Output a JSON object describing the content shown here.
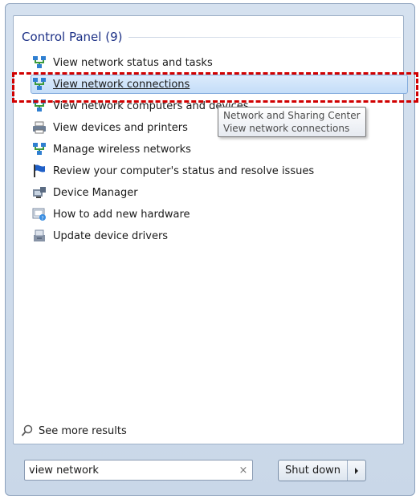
{
  "start_menu": {
    "group_title": "Control Panel (9)",
    "items": [
      {
        "label": "View network status and tasks",
        "icon": "network-icon"
      },
      {
        "label": "View network connections",
        "icon": "network-icon",
        "selected": true
      },
      {
        "label": "View network computers and devices",
        "icon": "network-icon"
      },
      {
        "label": "View devices and printers",
        "icon": "printer-icon"
      },
      {
        "label": "Manage wireless networks",
        "icon": "network-icon"
      },
      {
        "label": "Review your computer's status and resolve issues",
        "icon": "flag-icon"
      },
      {
        "label": "Device Manager",
        "icon": "device-manager-icon"
      },
      {
        "label": "How to add new hardware",
        "icon": "hardware-icon"
      },
      {
        "label": "Update device drivers",
        "icon": "driver-icon"
      }
    ],
    "tooltip": {
      "line1": "Network and Sharing Center",
      "line2": "View network connections"
    },
    "see_more": "See more results",
    "search": {
      "value": "view network",
      "clear": "×"
    },
    "shutdown": {
      "label": "Shut down"
    }
  },
  "colors": {
    "header": "#1e3287",
    "highlight": "#d10000",
    "selection": "#c4ddf8"
  }
}
